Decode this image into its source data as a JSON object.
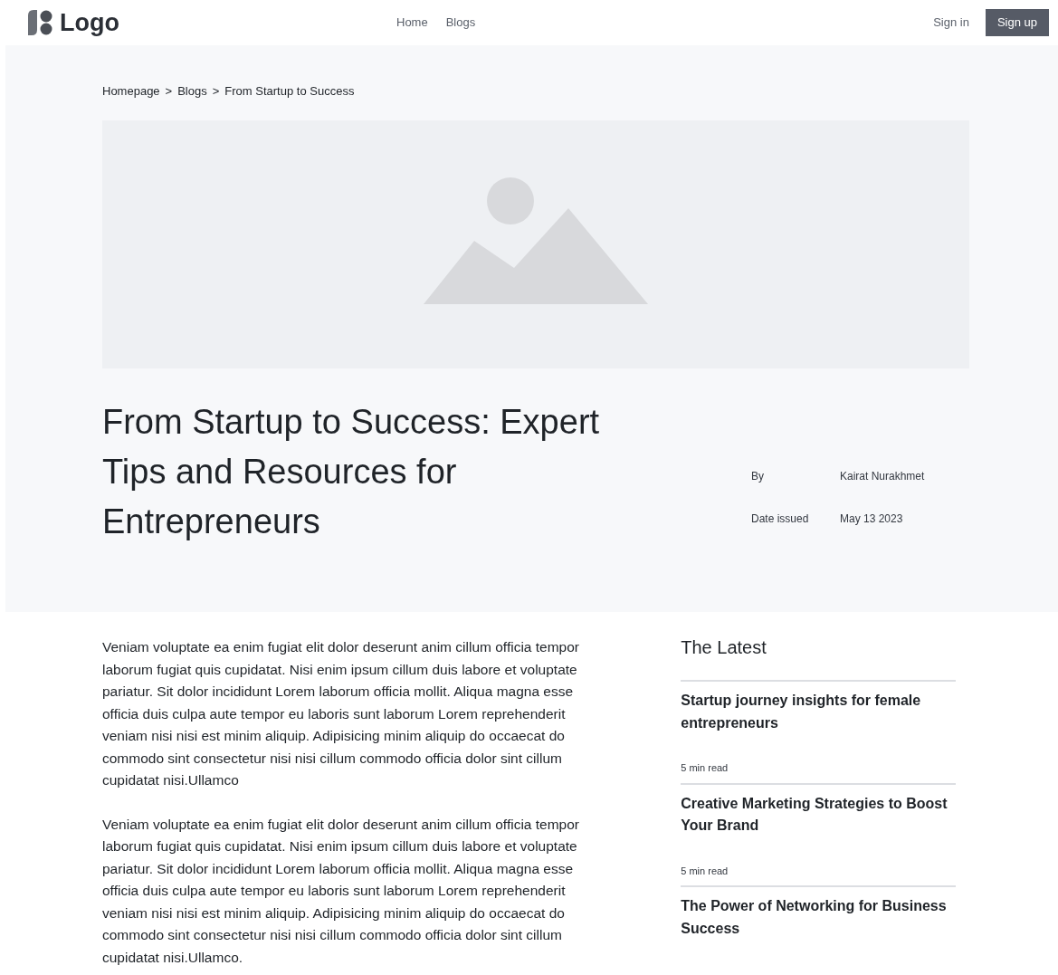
{
  "header": {
    "logo": "Logo",
    "nav": [
      {
        "label": "Home"
      },
      {
        "label": "Blogs"
      }
    ],
    "sign_in": "Sign in",
    "sign_up": "Sign up"
  },
  "breadcrumb": {
    "separator": ">",
    "items": [
      "Homepage",
      "Blogs",
      "From Startup to Success"
    ]
  },
  "hero": {
    "kind": "image-placeholder",
    "title": "From Startup to Success: Expert Tips and Resources for Entrepreneurs",
    "meta": [
      {
        "label": "By",
        "value": "Kairat Nurakhmet"
      },
      {
        "label": "Date issued",
        "value": "May 13 2023"
      }
    ]
  },
  "article": {
    "paragraphs": [
      "Veniam voluptate ea enim fugiat elit dolor deserunt anim cillum officia tempor laborum fugiat quis cupidatat. Nisi enim ipsum cillum duis labore et voluptate pariatur. Sit dolor incididunt Lorem laborum officia mollit. Aliqua magna esse officia duis culpa aute tempor eu laboris sunt laborum Lorem reprehenderit veniam nisi nisi est minim aliquip. Adipisicing minim aliquip do occaecat do commodo sint consectetur nisi nisi cillum commodo officia dolor sint cillum cupidatat nisi.Ullamco",
      "Veniam voluptate ea enim fugiat elit dolor deserunt anim cillum officia tempor laborum fugiat quis cupidatat. Nisi enim ipsum cillum duis labore et voluptate pariatur. Sit dolor incididunt Lorem laborum officia mollit. Aliqua magna esse officia duis culpa aute tempor eu laboris sunt laborum Lorem reprehenderit veniam nisi nisi est minim aliquip. Adipisicing minim aliquip do occaecat do commodo sint consectetur nisi nisi cillum commodo officia dolor sint cillum cupidatat nisi.Ullamco."
    ]
  },
  "latest": {
    "heading": "The Latest",
    "items": [
      {
        "title": "Startup journey insights for female entrepreneurs",
        "read_time": "5 min read"
      },
      {
        "title": "Creative Marketing Strategies to Boost Your Brand",
        "read_time": "5 min read"
      },
      {
        "title": "The Power of Networking for Business Success"
      }
    ]
  }
}
